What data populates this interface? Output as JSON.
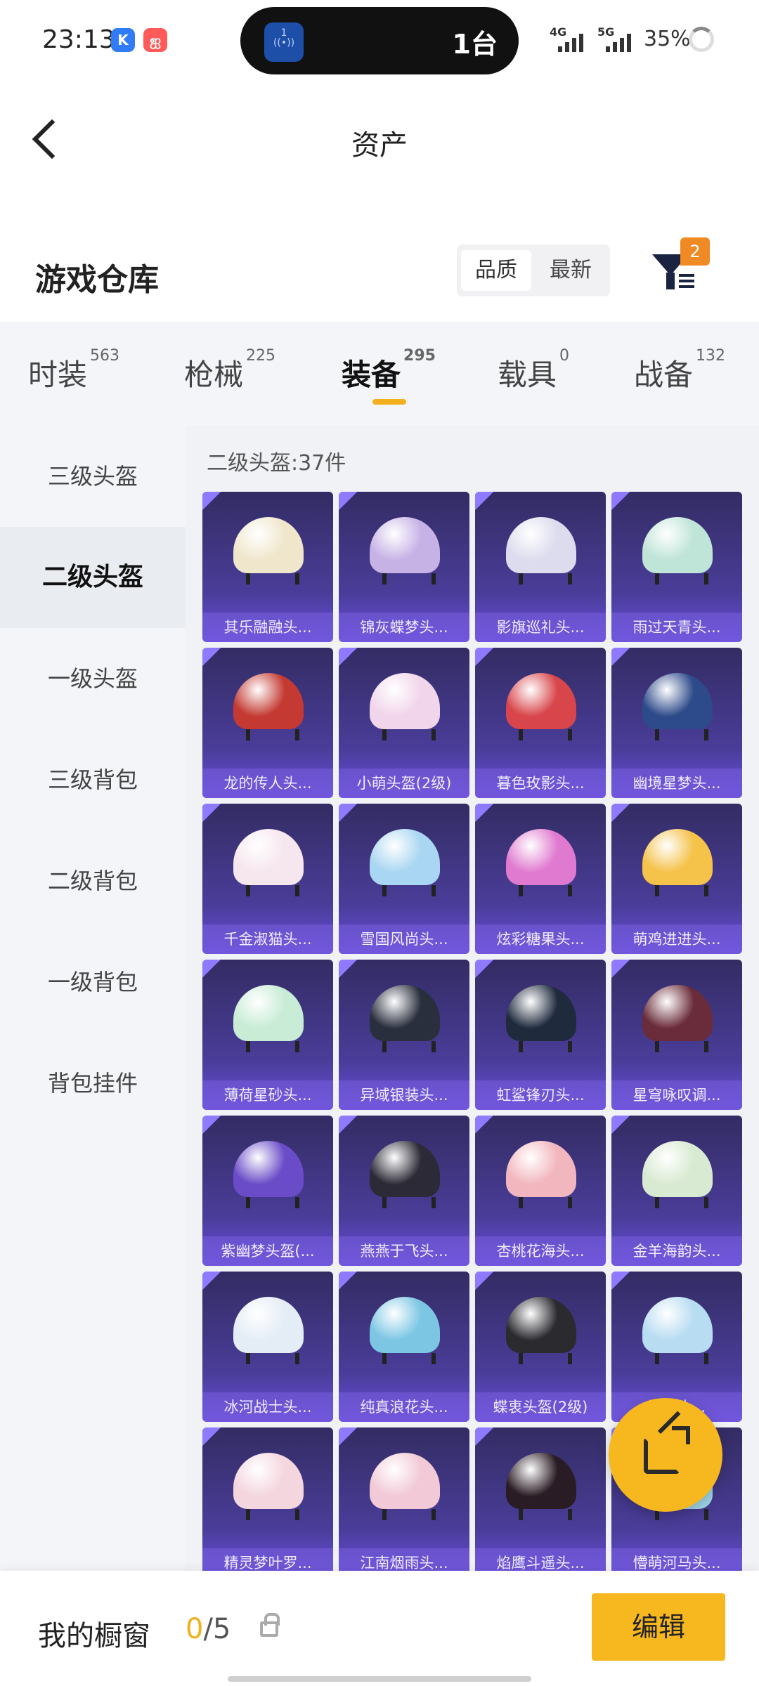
{
  "status_bar": {
    "time": "23:13",
    "app_icon_k": "K",
    "app_icon_p": "ஐ",
    "island_badge": "1",
    "island_text": "1台",
    "net1": "4G",
    "net2": "5G",
    "battery": "35%"
  },
  "header": {
    "title": "资产"
  },
  "warehouse": {
    "title": "游戏仓库",
    "sort_options": [
      "品质",
      "最新"
    ],
    "filter_badge": "2"
  },
  "tabs": [
    {
      "label": "时装",
      "count": "563"
    },
    {
      "label": "枪械",
      "count": "225"
    },
    {
      "label": "装备",
      "count": "295"
    },
    {
      "label": "载具",
      "count": "0"
    },
    {
      "label": "战备",
      "count": "132"
    }
  ],
  "sidebar": {
    "items": [
      "三级头盔",
      "二级头盔",
      "一级头盔",
      "三级背包",
      "二级背包",
      "一级背包",
      "背包挂件"
    ]
  },
  "content": {
    "section_label": "二级头盔:37件",
    "items": [
      {
        "name": "其乐融融头...",
        "color": "#efe6cc"
      },
      {
        "name": "锦灰蝶梦头...",
        "color": "#c7b2e6"
      },
      {
        "name": "影旗巡礼头...",
        "color": "#dcdcee"
      },
      {
        "name": "雨过天青头...",
        "color": "#bfe4d8"
      },
      {
        "name": "龙的传人头...",
        "color": "#c43a32"
      },
      {
        "name": "小萌头盔(2级)",
        "color": "#f1d5ea"
      },
      {
        "name": "暮色玫影头...",
        "color": "#d8454a"
      },
      {
        "name": "幽境星梦头...",
        "color": "#2d4a8a"
      },
      {
        "name": "千金淑猫头...",
        "color": "#f6e6ee"
      },
      {
        "name": "雪国风尚头...",
        "color": "#a9d6f2"
      },
      {
        "name": "炫彩糖果头...",
        "color": "#e07ad0"
      },
      {
        "name": "萌鸡进进头...",
        "color": "#f5c24a"
      },
      {
        "name": "薄荷星砂头...",
        "color": "#c8ecd6"
      },
      {
        "name": "异域银装头...",
        "color": "#2a2f3e"
      },
      {
        "name": "虹鲨锋刃头...",
        "color": "#1f2a3d"
      },
      {
        "name": "星穹咏叹调...",
        "color": "#6a2c3a"
      },
      {
        "name": "紫幽梦头盔(...",
        "color": "#6a4cc8"
      },
      {
        "name": "燕燕于飞头...",
        "color": "#2b2a36"
      },
      {
        "name": "杏桃花海头...",
        "color": "#f2b6be"
      },
      {
        "name": "金羊海韵头...",
        "color": "#d9ead2"
      },
      {
        "name": "冰河战士头...",
        "color": "#e4edf6"
      },
      {
        "name": "纯真浪花头...",
        "color": "#7cc6e4"
      },
      {
        "name": "蝶衷头盔(2级)",
        "color": "#2a2a2f"
      },
      {
        "name": "海...头...",
        "color": "#b8dcf2"
      },
      {
        "name": "精灵梦叶罗...",
        "color": "#f4d6df"
      },
      {
        "name": "江南烟雨头...",
        "color": "#f2c9d6"
      },
      {
        "name": "焰鹰斗遥头...",
        "color": "#2a1c24"
      },
      {
        "name": "懵萌河马头...",
        "color": "#9fd4e6"
      }
    ]
  },
  "bottom": {
    "showcase_label": "我的橱窗",
    "showcase_current": "0",
    "showcase_total": "/5",
    "edit_label": "编辑"
  }
}
